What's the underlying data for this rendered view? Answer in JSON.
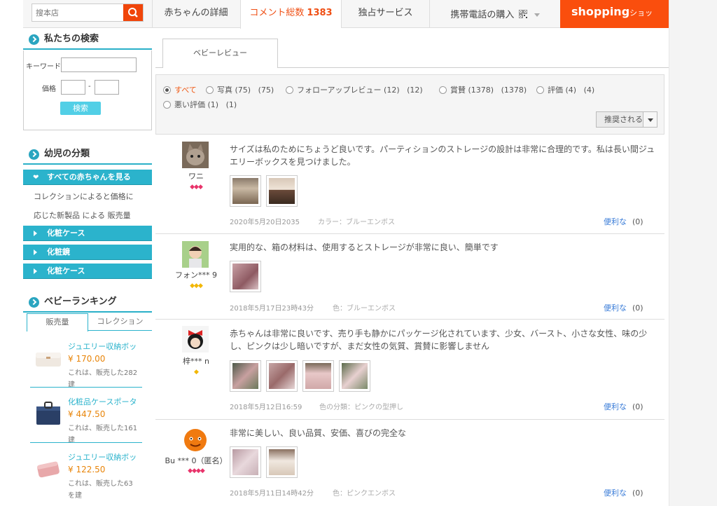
{
  "nav": {
    "search_placeholder": "搜本店",
    "tabs": [
      {
        "label": "赤ちゃんの詳細"
      },
      {
        "label": "コメント総数",
        "count": "1383"
      },
      {
        "label": "独占サービス"
      },
      {
        "label": "携帯電話の購入"
      }
    ],
    "shop_button": {
      "bold": "shopping",
      "small": "ショッ"
    }
  },
  "sidebar": {
    "search_title": "私たちの検索",
    "keyword_label": "キーワード",
    "price_label": "価格",
    "price_sep": "-",
    "search_button": "検索",
    "category_title": "幼児の分類",
    "all_babies": "すべての赤ちゃんを見る",
    "sub_links": [
      "コレクションによると価格に",
      "応じた新製品 による 販売量"
    ],
    "categories": [
      "化粧ケース",
      "化粧鏡",
      "化粧ケース"
    ],
    "ranking_title": "ベビーランキング",
    "ranking_tabs": [
      "販売量",
      "コレクション"
    ],
    "ranking_items": [
      {
        "name": "ジュエリー収納ボッ",
        "price": "¥ 170.00",
        "sold": "これは、販売した282建"
      },
      {
        "name": "化粧品ケースポータ",
        "price": "¥ 447.50",
        "sold": "これは、販売した161建"
      },
      {
        "name": "ジュエリー収納ボッ",
        "price": "¥ 122.50",
        "sold": "これは、販売した63を建"
      }
    ]
  },
  "main": {
    "tab_label": "ベビーレビュー",
    "filters": [
      {
        "label": "すべて",
        "count": "",
        "selected": true
      },
      {
        "label": "写真 (75)",
        "count": "(75)",
        "selected": false
      },
      {
        "label": "フォローアップレビュー (12)",
        "count": "(12)",
        "selected": false
      },
      {
        "label": "賞賛 (1378)",
        "count": "(1378)",
        "selected": false
      },
      {
        "label": "評価 (4)",
        "count": "(4)",
        "selected": false
      },
      {
        "label": "悪い評価 (1)",
        "count": "(1)",
        "selected": false
      }
    ],
    "sort_label": "推奨される",
    "reviews": [
      {
        "user": "ワニ",
        "gem_color": "#e8336a",
        "gems": "◆◆◆",
        "text": "サイズは私のためにちょうど良いです。パーティションのストレージの設計は非常に合理的です。私は長い間ジュエリーボックスを見つけました。",
        "date": "2020年5月20日2035",
        "color": "カラー：ブルーエンボス",
        "helpful": "便利な",
        "helpful_count": "(0)",
        "photos": 2
      },
      {
        "user": "フォン*** 9",
        "gem_color": "#f2b705",
        "gems": "◆◆◆",
        "text": "実用的な、箱の材料は、使用するとストレージが非常に良い、簡単です",
        "date": "2018年5月17日23時43分",
        "color": "色：ブルーエンボス",
        "helpful": "便利な",
        "helpful_count": "(0)",
        "photos": 1
      },
      {
        "user": "梓*** n",
        "gem_color": "#f2b705",
        "gems": "◆",
        "text": "赤ちゃんは非常に良いです、売り手も静かにパッケージ化されています、少女、バースト、小さな女性、味の少し、ピンクは少し暗いですが、まだ女性の気質、賞賛に影響しません",
        "date": "2018年5月12日16:59",
        "color": "色の分類：ピンクの型押し",
        "helpful": "便利な",
        "helpful_count": "(0)",
        "photos": 4
      },
      {
        "user": "Bu *** 0（匿名）",
        "gem_color": "#e8336a",
        "gems": "◆◆◆◆",
        "text": "非常に美しい、良い品質、安価、喜びの完全な",
        "date": "2018年5月11日14時42分",
        "color": "色：ピンクエンボス",
        "helpful": "便利な",
        "helpful_count": "(0)",
        "photos": 2
      }
    ]
  },
  "colors": {
    "accent": "#2bb3cc",
    "orange": "#fa4e0d",
    "link": "#3b7dd8"
  }
}
